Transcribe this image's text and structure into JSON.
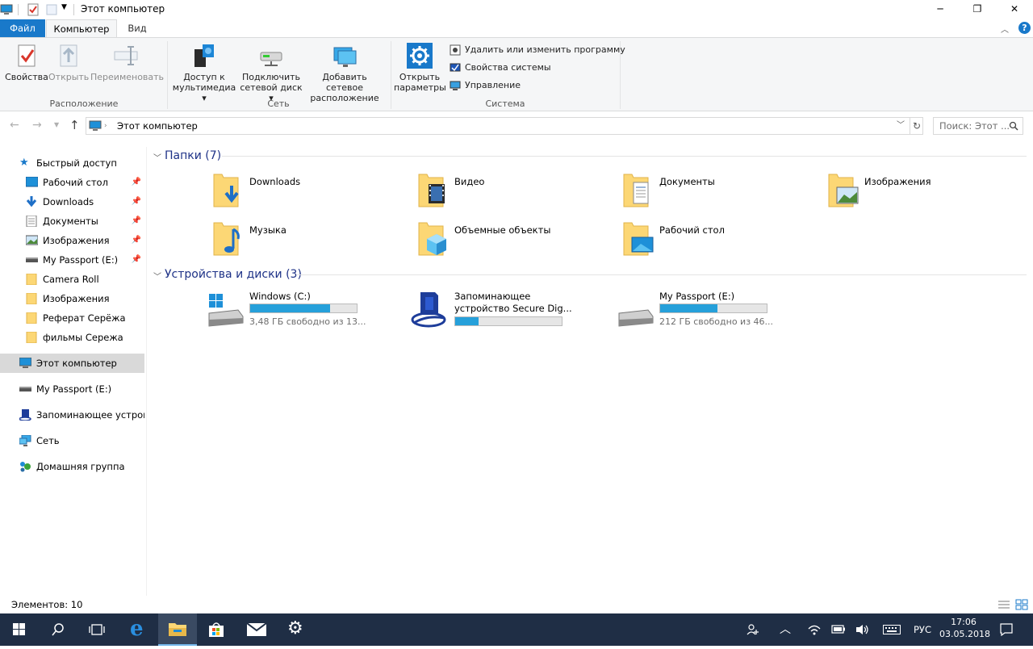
{
  "window": {
    "title": "Этот компьютер",
    "minimize": "─",
    "maximize": "❐",
    "close": "✕"
  },
  "ribbon_tabs": {
    "file": "Файл",
    "computer": "Компьютер",
    "view": "Вид"
  },
  "ribbon": {
    "location": {
      "label": "Расположение",
      "properties": "Свойства",
      "open": "Открыть",
      "rename": "Переименовать"
    },
    "network": {
      "label": "Сеть",
      "media_access_1": "Доступ к",
      "media_access_2": "мультимедиа",
      "map_drive_1": "Подключить",
      "map_drive_2": "сетевой диск",
      "add_location_1": "Добавить сетевое",
      "add_location_2": "расположение"
    },
    "system": {
      "label": "Система",
      "open_settings_1": "Открыть",
      "open_settings_2": "параметры",
      "uninstall": "Удалить или изменить программу",
      "system_properties": "Свойства системы",
      "manage": "Управление"
    }
  },
  "address": {
    "path": "Этот компьютер",
    "search_placeholder": "Поиск: Этот ..."
  },
  "nav": {
    "quick_access": "Быстрый доступ",
    "quick_items": [
      {
        "label": "Рабочий стол",
        "pinned": true
      },
      {
        "label": "Downloads",
        "pinned": true
      },
      {
        "label": "Документы",
        "pinned": true
      },
      {
        "label": "Изображения",
        "pinned": true
      },
      {
        "label": "My Passport (E:)",
        "pinned": true
      },
      {
        "label": "Camera Roll",
        "pinned": false
      },
      {
        "label": "Изображения",
        "pinned": false
      },
      {
        "label": "Реферат Серёжа",
        "pinned": false
      },
      {
        "label": "фильмы Сережа",
        "pinned": false
      }
    ],
    "this_pc": "Этот компьютер",
    "my_passport": "My Passport (E:)",
    "sd_storage": "Запоминающее устройство",
    "network": "Сеть",
    "homegroup": "Домашняя группа"
  },
  "folders": {
    "heading": "Папки (7)",
    "items": [
      "Downloads",
      "Видео",
      "Документы",
      "Изображения",
      "Музыка",
      "Объемные объекты",
      "Рабочий стол"
    ]
  },
  "devices": {
    "heading": "Устройства и диски (3)",
    "items": [
      {
        "name": "Windows (C:)",
        "sub": "3,48 ГБ свободно из 13...",
        "fill": 0.75
      },
      {
        "name_1": "Запоминающее",
        "name_2": "устройство Secure Dig...",
        "fill": 0.22
      },
      {
        "name": "My Passport (E:)",
        "sub": "212 ГБ свободно из 46...",
        "fill": 0.54
      }
    ]
  },
  "status": {
    "items": "Элементов: 10"
  },
  "taskbar": {
    "language": "РУС",
    "time": "17:06",
    "date": "03.05.2018"
  },
  "colors": {
    "accent": "#1979ca",
    "heading": "#1e3287",
    "taskbar": "#1f2e45",
    "drive_fill": "#26a0da"
  }
}
